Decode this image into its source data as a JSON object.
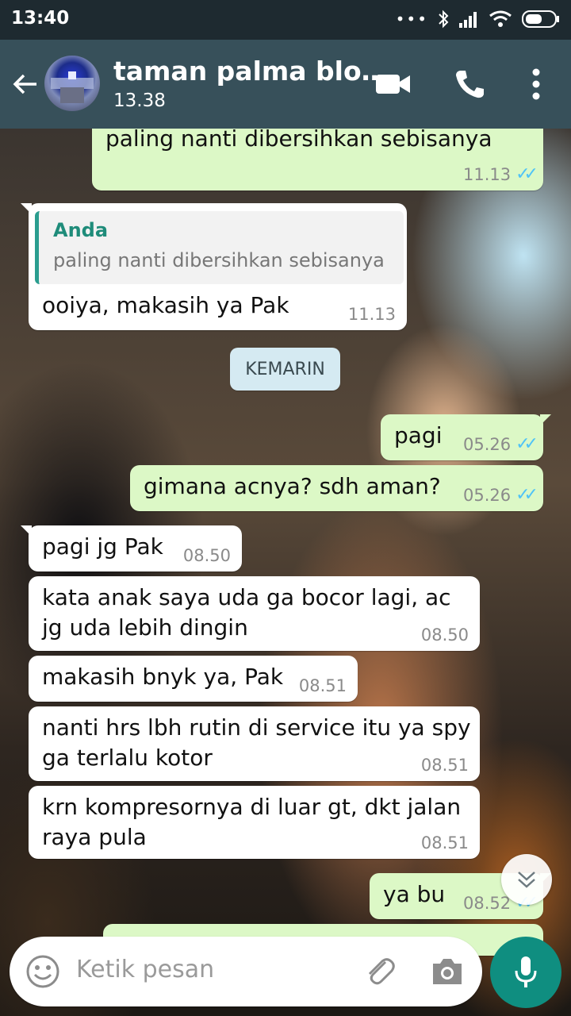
{
  "status_bar": {
    "time": "13:40"
  },
  "header": {
    "title": "taman palma blo…",
    "subtitle": "13.38"
  },
  "messages": [
    {
      "dir": "out",
      "text": "paling nanti dibersihkan sebisanya",
      "time": "11.13"
    },
    {
      "dir": "in",
      "quote_author": "Anda",
      "quote_text": "paling nanti dibersihkan sebisanya",
      "text": "ooiya, makasih ya Pak",
      "time": "11.13"
    },
    {
      "dir": "out",
      "text": "pagi",
      "time": "05.26"
    },
    {
      "dir": "out",
      "text": "gimana acnya? sdh aman?",
      "time": "05.26"
    },
    {
      "dir": "in",
      "text": "pagi jg Pak",
      "time": "08.50"
    },
    {
      "dir": "in",
      "text_line1": "kata anak saya uda ga bocor lagi, ac",
      "text_line2": "jg uda lebih dingin",
      "time": "08.50"
    },
    {
      "dir": "in",
      "text": "makasih bnyk ya, Pak",
      "time": "08.51"
    },
    {
      "dir": "in",
      "text_line1": "nanti hrs lbh rutin di service itu ya spy",
      "text_line2": "ga terlalu kotor",
      "time": "08.51"
    },
    {
      "dir": "in",
      "text_line1": "krn kompresornya di luar gt, dkt jalan",
      "text_line2": "raya pula",
      "time": "08.51"
    },
    {
      "dir": "out",
      "text": "ya bu",
      "time": "08.52"
    }
  ],
  "day_separator": "KEMARIN",
  "composer": {
    "placeholder": "Ketik pesan"
  },
  "icons": [
    "back-arrow",
    "video-call",
    "phone",
    "more-vert",
    "emoji",
    "attach",
    "camera",
    "mic",
    "scroll-down"
  ],
  "colors": {
    "header": "#37505a",
    "status_bar": "#1e2a30",
    "outgoing": "#dcf8c6",
    "incoming": "#ffffff",
    "read_ticks": "#4fc3f7",
    "mic": "#0f8e80",
    "quote_bar": "#2a9d8f"
  }
}
